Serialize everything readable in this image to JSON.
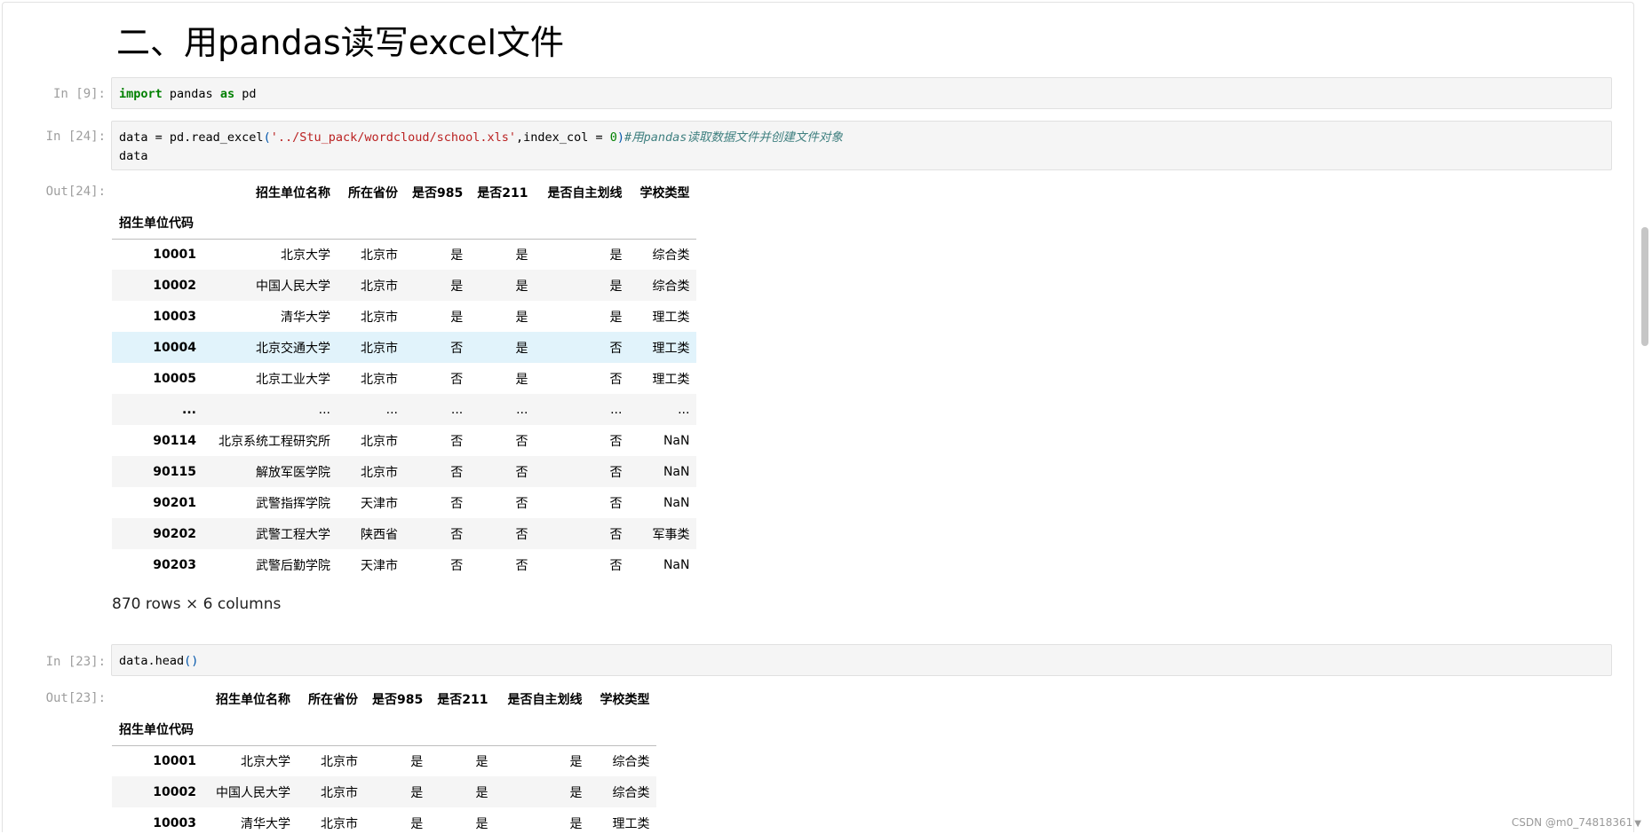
{
  "heading": "二、用pandas读写excel文件",
  "cells": {
    "c9": {
      "prompt": "In [9]:",
      "tokens": [
        "import",
        " pandas ",
        "as",
        " pd"
      ]
    },
    "c24": {
      "prompt": "In [24]:",
      "line1": [
        "data = pd.read_excel",
        "(",
        "'../Stu_pack/wordcloud/school.xls'",
        ",index_col = ",
        "0",
        ")",
        "#用pandas读取数据文件并创建文件对象"
      ],
      "line2": "data"
    },
    "out24": {
      "prompt": "Out[24]:"
    },
    "c23": {
      "prompt": "In [23]:",
      "tokens": [
        "data.head",
        "()"
      ]
    },
    "out23": {
      "prompt": "Out[23]:"
    }
  },
  "table": {
    "columns": [
      "招生单位名称",
      "所在省份",
      "是否985",
      "是否211",
      "是否自主划线",
      "学校类型"
    ],
    "index_name": "招生单位代码",
    "rows": [
      [
        "10001",
        "北京大学",
        "北京市",
        "是",
        "是",
        "是",
        "综合类"
      ],
      [
        "10002",
        "中国人民大学",
        "北京市",
        "是",
        "是",
        "是",
        "综合类"
      ],
      [
        "10003",
        "清华大学",
        "北京市",
        "是",
        "是",
        "是",
        "理工类"
      ],
      [
        "10004",
        "北京交通大学",
        "北京市",
        "否",
        "是",
        "否",
        "理工类"
      ],
      [
        "10005",
        "北京工业大学",
        "北京市",
        "否",
        "是",
        "否",
        "理工类"
      ],
      [
        "...",
        "...",
        "...",
        "...",
        "...",
        "...",
        "..."
      ],
      [
        "90114",
        "北京系统工程研究所",
        "北京市",
        "否",
        "否",
        "否",
        "NaN"
      ],
      [
        "90115",
        "解放军医学院",
        "北京市",
        "否",
        "否",
        "否",
        "NaN"
      ],
      [
        "90201",
        "武警指挥学院",
        "天津市",
        "否",
        "否",
        "否",
        "NaN"
      ],
      [
        "90202",
        "武警工程大学",
        "陕西省",
        "否",
        "否",
        "否",
        "军事类"
      ],
      [
        "90203",
        "武警后勤学院",
        "天津市",
        "否",
        "否",
        "否",
        "NaN"
      ]
    ],
    "shape": "870 rows × 6 columns"
  },
  "head_table": {
    "columns": [
      "招生单位名称",
      "所在省份",
      "是否985",
      "是否211",
      "是否自主划线",
      "学校类型"
    ],
    "index_name": "招生单位代码",
    "rows": [
      [
        "10001",
        "北京大学",
        "北京市",
        "是",
        "是",
        "是",
        "综合类"
      ],
      [
        "10002",
        "中国人民大学",
        "北京市",
        "是",
        "是",
        "是",
        "综合类"
      ],
      [
        "10003",
        "清华大学",
        "北京市",
        "是",
        "是",
        "是",
        "理工类"
      ]
    ]
  },
  "watermark": "CSDN @m0_74818361"
}
